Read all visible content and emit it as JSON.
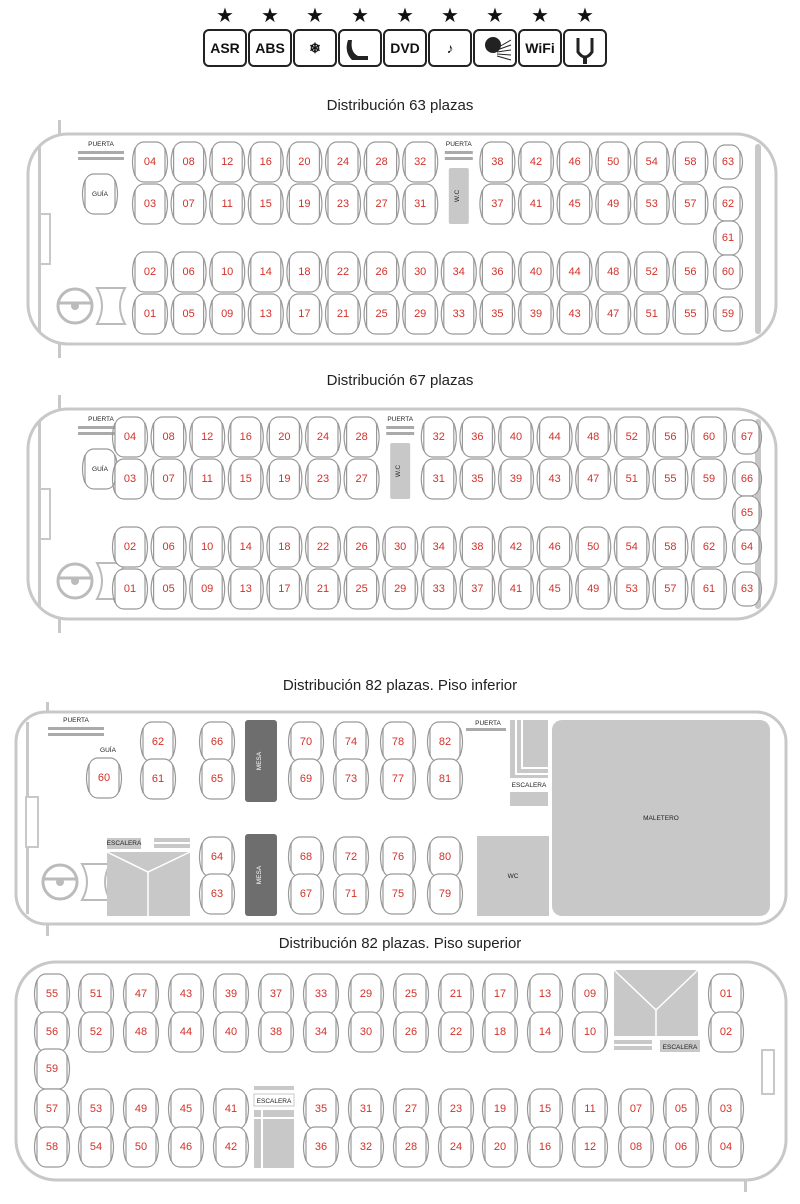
{
  "ratings": {
    "stars": "★★★★★★★★★",
    "icons": [
      {
        "name": "asr-icon",
        "text": "ASR"
      },
      {
        "name": "abs-icon",
        "text": "ABS"
      },
      {
        "name": "snowflake-icon",
        "text": "❄"
      },
      {
        "name": "reclining-seat-icon",
        "text": ""
      },
      {
        "name": "dvd-icon",
        "text": "DVD"
      },
      {
        "name": "music-icon",
        "text": "♪"
      },
      {
        "name": "light-icon",
        "text": ""
      },
      {
        "name": "wifi-icon",
        "text": "WiFi"
      },
      {
        "name": "usb-icon",
        "text": ""
      }
    ]
  },
  "labels": {
    "puerta": "PUERTA",
    "guia": "GUÍA",
    "wc_vertical": "W.C",
    "wc": "WC",
    "mesa": "MESA",
    "escalera": "ESCALERA",
    "maletero": "MALETERO"
  },
  "sections": {
    "d63": {
      "title": "Distribución 63 plazas",
      "top_front": [
        "04",
        "08",
        "12",
        "16",
        "20",
        "24",
        "28",
        "32"
      ],
      "bottom_front": [
        "03",
        "07",
        "11",
        "15",
        "19",
        "23",
        "27",
        "31"
      ],
      "top_back": [
        "38",
        "42",
        "46",
        "50",
        "54",
        "58"
      ],
      "bottom_back": [
        "37",
        "41",
        "45",
        "49",
        "53",
        "57"
      ],
      "row3": [
        "02",
        "06",
        "10",
        "14",
        "18",
        "22",
        "26",
        "30",
        "34",
        "36",
        "40",
        "44",
        "48",
        "52",
        "56"
      ],
      "row4": [
        "01",
        "05",
        "09",
        "13",
        "17",
        "21",
        "25",
        "29",
        "33",
        "35",
        "39",
        "43",
        "47",
        "51",
        "55"
      ],
      "rear": [
        "63",
        "62",
        "61",
        "60",
        "59"
      ]
    },
    "d67": {
      "title": "Distribución 67 plazas",
      "top_front": [
        "04",
        "08",
        "12",
        "16",
        "20",
        "24",
        "28"
      ],
      "bottom_front": [
        "03",
        "07",
        "11",
        "15",
        "19",
        "23",
        "27"
      ],
      "top_back": [
        "32",
        "36",
        "40",
        "44",
        "48",
        "52",
        "56",
        "60"
      ],
      "bottom_back": [
        "31",
        "35",
        "39",
        "43",
        "47",
        "51",
        "55",
        "59"
      ],
      "row3": [
        "02",
        "06",
        "10",
        "14",
        "18",
        "22",
        "26",
        "30",
        "34",
        "38",
        "42",
        "46",
        "50",
        "54",
        "58",
        "62"
      ],
      "row4": [
        "01",
        "05",
        "09",
        "13",
        "17",
        "21",
        "25",
        "29",
        "33",
        "37",
        "41",
        "45",
        "49",
        "53",
        "57",
        "61"
      ],
      "rear": [
        "67",
        "66",
        "65",
        "64",
        "63"
      ]
    },
    "lower": {
      "title": "Distribución 82 plazas. Piso inferior",
      "guide": "60",
      "col1_top": [
        "62",
        "61"
      ],
      "col2_top": [
        "66",
        "65"
      ],
      "top_pairs": [
        [
          "70",
          "69"
        ],
        [
          "74",
          "73"
        ],
        [
          "78",
          "77"
        ],
        [
          "82",
          "81"
        ]
      ],
      "col2_bottom": [
        "64",
        "63"
      ],
      "bottom_pairs": [
        [
          "68",
          "67"
        ],
        [
          "72",
          "71"
        ],
        [
          "76",
          "75"
        ],
        [
          "80",
          "79"
        ]
      ]
    },
    "upper": {
      "title": "Distribución 82 plazas. Piso superior",
      "row1": [
        "55",
        "51",
        "47",
        "43",
        "39",
        "37",
        "33",
        "29",
        "25",
        "21",
        "17",
        "13",
        "09"
      ],
      "row2": [
        "56",
        "52",
        "48",
        "44",
        "40",
        "38",
        "34",
        "30",
        "26",
        "22",
        "18",
        "14",
        "10"
      ],
      "left_extra": "59",
      "row3a": [
        "57",
        "53",
        "49",
        "45",
        "41"
      ],
      "row3b": [
        "35",
        "31",
        "27",
        "23",
        "19",
        "15",
        "11",
        "07",
        "05",
        "03"
      ],
      "row4a": [
        "58",
        "54",
        "50",
        "46",
        "42"
      ],
      "row4b": [
        "36",
        "32",
        "28",
        "24",
        "20",
        "16",
        "12",
        "08",
        "06",
        "04"
      ],
      "front": [
        "01",
        "02"
      ]
    }
  }
}
